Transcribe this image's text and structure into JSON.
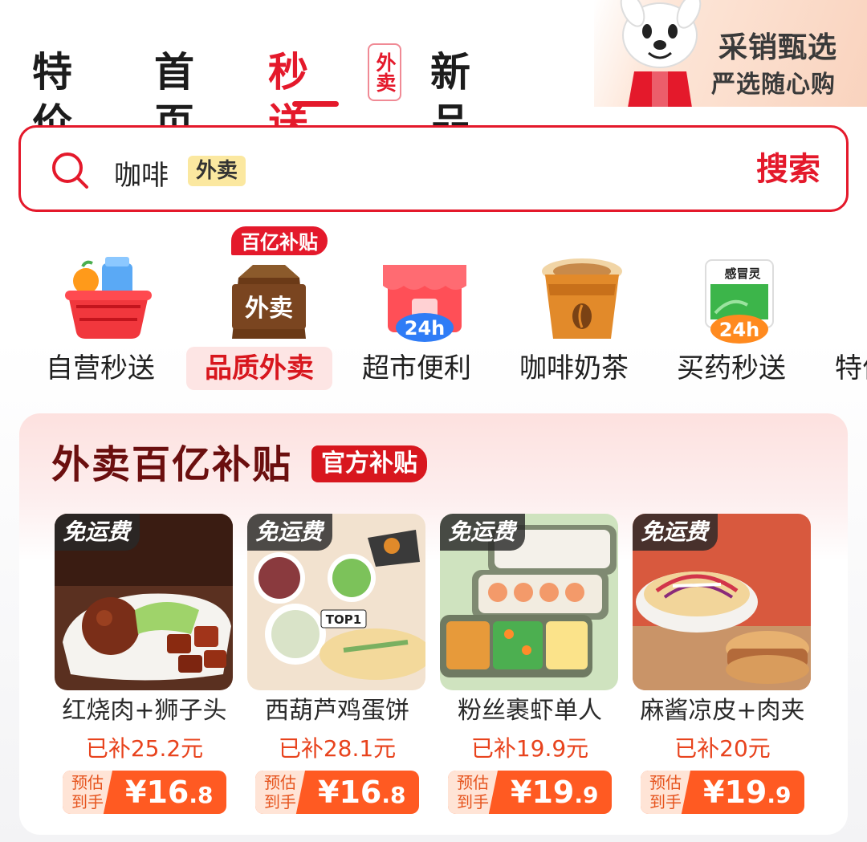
{
  "tabs": [
    {
      "label": "特价"
    },
    {
      "label": "首页"
    },
    {
      "label": "秒送",
      "badge": "外卖",
      "active": true
    },
    {
      "label": "新品"
    }
  ],
  "promo": {
    "title": "采销甄选",
    "subtitle": "严选随心购"
  },
  "search": {
    "query": "咖啡",
    "tag": "外卖",
    "button": "搜索",
    "icon": "search-icon"
  },
  "categories": [
    {
      "label": "自营秒送",
      "icon": "basket-icon"
    },
    {
      "label": "品质外卖",
      "icon": "takeout-bag-icon",
      "ribbon": "百亿补贴",
      "bag_text": "外卖",
      "active": true
    },
    {
      "label": "超市便利",
      "icon": "store-24h-icon",
      "badge": "24h"
    },
    {
      "label": "咖啡奶茶",
      "icon": "coffee-cup-icon"
    },
    {
      "label": "买药秒送",
      "icon": "medicine-box-icon",
      "badge": "24h",
      "box_text": "感冒灵"
    },
    {
      "label": "特价",
      "icon": "tag-icon"
    }
  ],
  "subsidy": {
    "title": "外卖百亿补贴",
    "tag": "官方补贴",
    "items": [
      {
        "badge": "免运费",
        "name": "红烧肉+狮子头",
        "subsidy": "已补25.2元",
        "price_label": "预估到手",
        "price_main": "¥16",
        "price_dec": ".8"
      },
      {
        "badge": "免运费",
        "name": "西葫芦鸡蛋饼",
        "subsidy": "已补28.1元",
        "price_label": "预估到手",
        "price_main": "¥16",
        "price_dec": ".8",
        "img_label": "TOP1"
      },
      {
        "badge": "免运费",
        "name": "粉丝裹虾单人",
        "subsidy": "已补19.9元",
        "price_label": "预估到手",
        "price_main": "¥19",
        "price_dec": ".9"
      },
      {
        "badge": "免运费",
        "name": "麻酱凉皮+肉夹",
        "subsidy": "已补20元",
        "price_label": "预估到手",
        "price_main": "¥19",
        "price_dec": ".9"
      }
    ]
  },
  "colors": {
    "accent": "#e4192b",
    "price": "#ff5a22",
    "subsidy_text": "#e8431d"
  }
}
